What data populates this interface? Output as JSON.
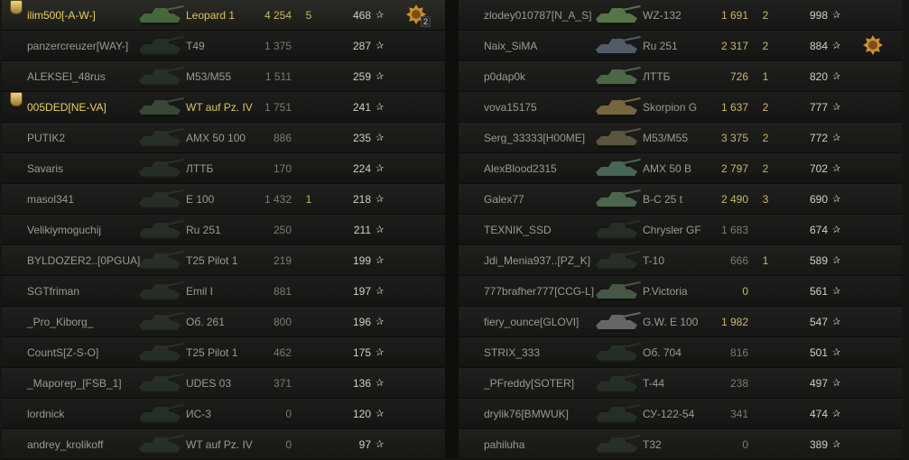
{
  "teams": [
    {
      "id": "left",
      "players": [
        {
          "name": "ilim500[-A-W-]",
          "vehicle": "Leopard 1",
          "damage": "4 254",
          "kills": "5",
          "score": "468",
          "platoon": true,
          "medal": true,
          "medal_count": "2",
          "tank_color": "#4a6a3c"
        },
        {
          "name": "panzercreuzer[WAY-]",
          "vehicle": "T49",
          "damage": "1 375",
          "kills": "",
          "score": "287",
          "tank_color": "#3a4a38"
        },
        {
          "name": "ALEKSEI_48rus",
          "vehicle": "M53/M55",
          "damage": "1 511",
          "kills": "",
          "score": "259",
          "tank_color": "#3a4a38"
        },
        {
          "name": "005DED[NE-VA]",
          "vehicle": "WT auf Pz. IV",
          "damage": "1 751",
          "kills": "",
          "score": "241",
          "platoon": true,
          "tank_color": "#3a4a38"
        },
        {
          "name": "PUTIK2",
          "vehicle": "AMX 50 100",
          "damage": "886",
          "kills": "",
          "score": "235",
          "tank_color": "#3a4a38"
        },
        {
          "name": "Savaris",
          "vehicle": "ЛТТБ",
          "damage": "170",
          "kills": "",
          "score": "224",
          "tank_color": "#3a4a38"
        },
        {
          "name": "masol341",
          "vehicle": "E 100",
          "damage": "1 432",
          "kills": "1",
          "score": "218",
          "tank_color": "#3a4a38"
        },
        {
          "name": "Velikiymoguchij",
          "vehicle": "Ru 251",
          "damage": "250",
          "kills": "",
          "score": "211",
          "tank_color": "#3a4a38"
        },
        {
          "name": "BYLDOZER2..[0PGUA]",
          "vehicle": "T25 Pilot 1",
          "damage": "219",
          "kills": "",
          "score": "199",
          "tank_color": "#3a4a38"
        },
        {
          "name": "SGTfriman",
          "vehicle": "Emil I",
          "damage": "881",
          "kills": "",
          "score": "197",
          "tank_color": "#3a4a38"
        },
        {
          "name": "_Pro_Kiborg_",
          "vehicle": "Об. 261",
          "damage": "800",
          "kills": "",
          "score": "196",
          "tank_color": "#3a4a38"
        },
        {
          "name": "CountS[Z-S-O]",
          "vehicle": "T25 Pilot 1",
          "damage": "462",
          "kills": "",
          "score": "175",
          "tank_color": "#3a4a38"
        },
        {
          "name": "_Маpoгep_[FSB_1]",
          "vehicle": "UDES 03",
          "damage": "371",
          "kills": "",
          "score": "136",
          "tank_color": "#3a4a38"
        },
        {
          "name": "lordnick",
          "vehicle": "ИС-3",
          "damage": "0",
          "kills": "",
          "score": "120",
          "tank_color": "#3a4a38"
        },
        {
          "name": "andrey_krolikoff",
          "vehicle": "WT auf Pz. IV",
          "damage": "0",
          "kills": "",
          "score": "97",
          "tank_color": "#3a4a38"
        }
      ]
    },
    {
      "id": "right",
      "players": [
        {
          "name": "zlodey010787[N_A_S]",
          "vehicle": "WZ-132",
          "damage": "1 691",
          "kills": "2",
          "score": "998",
          "alive": true,
          "tank_color": "#5a7a4a"
        },
        {
          "name": "Naix_SiMA",
          "vehicle": "Ru 251",
          "damage": "2 317",
          "kills": "2",
          "score": "884",
          "alive": true,
          "medal": true,
          "tank_color": "#55606a"
        },
        {
          "name": "p0dap0k",
          "vehicle": "ЛТТБ",
          "damage": "726",
          "kills": "1",
          "score": "820",
          "alive": true,
          "tank_color": "#506a4a"
        },
        {
          "name": "vova15175",
          "vehicle": "Skorpion G",
          "damage": "1 637",
          "kills": "2",
          "score": "777",
          "alive": true,
          "tank_color": "#7a6a40"
        },
        {
          "name": "Serg_33333[H00ME]",
          "vehicle": "M53/M55",
          "damage": "3 375",
          "kills": "2",
          "score": "772",
          "alive": true,
          "tank_color": "#5e5a40"
        },
        {
          "name": "AlexBlood2315",
          "vehicle": "AMX 50 B",
          "damage": "2 797",
          "kills": "2",
          "score": "702",
          "alive": true,
          "tank_color": "#4a6a5a"
        },
        {
          "name": "Galex77",
          "vehicle": "B-C 25 t",
          "damage": "2 490",
          "kills": "3",
          "score": "690",
          "alive": true,
          "tank_color": "#4e6a50"
        },
        {
          "name": "TEXNIK_SSD",
          "vehicle": "Chrysler GF",
          "damage": "1 683",
          "kills": "",
          "score": "674",
          "tank_color": "#3a4a38"
        },
        {
          "name": "Jdi_Menia937..[PZ_K]",
          "vehicle": "T-10",
          "damage": "666",
          "kills": "1",
          "score": "589",
          "tank_color": "#3a4a38"
        },
        {
          "name": "777brafher777[CCG-L]",
          "vehicle": "P.Victoria",
          "damage": "0",
          "kills": "",
          "score": "561",
          "alive": true,
          "tank_color": "#4a5a48"
        },
        {
          "name": "fiery_ounce[GLOVI]",
          "vehicle": "G.W. E 100",
          "damage": "1 982",
          "kills": "",
          "score": "547",
          "alive": true,
          "tank_color": "#6a6a6a"
        },
        {
          "name": "STRIX_333",
          "vehicle": "Об. 704",
          "damage": "816",
          "kills": "",
          "score": "501",
          "tank_color": "#3a4a38"
        },
        {
          "name": "_PFreddy[SOTER]",
          "vehicle": "T-44",
          "damage": "238",
          "kills": "",
          "score": "497",
          "tank_color": "#3a4a38"
        },
        {
          "name": "drylik76[BMWUK]",
          "vehicle": "СУ-122-54",
          "damage": "341",
          "kills": "",
          "score": "474",
          "tank_color": "#3a4a38"
        },
        {
          "name": "pahiluha",
          "vehicle": "T32",
          "damage": "0",
          "kills": "",
          "score": "389",
          "tank_color": "#3a4a38"
        }
      ]
    }
  ],
  "icons": {
    "star": "star-icon",
    "platoon": "platoon-badge-icon",
    "medal": "medal-icon"
  },
  "colors": {
    "platoon": "#e8d35a",
    "damage_hi": "#c9b768",
    "background": "#161615"
  }
}
